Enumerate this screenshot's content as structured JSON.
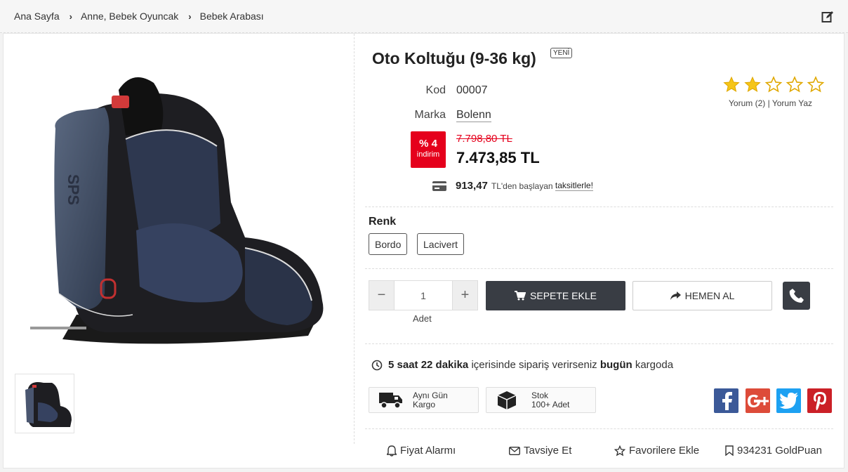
{
  "breadcrumb": {
    "items": [
      "Ana Sayfa",
      "Anne, Bebek Oyuncak",
      "Bebek Arabası"
    ]
  },
  "product": {
    "title": "Oto Koltuğu (9-36 kg)",
    "badge": "YENİ",
    "code_label": "Kod",
    "code_value": "00007",
    "brand_label": "Marka",
    "brand_value": "Bolenn",
    "discount_pct": "% 4",
    "discount_text": "indirim",
    "old_price": "7.798,80 TL",
    "new_price": "7.473,85 TL",
    "installment_amount": "913,47",
    "installment_text": "TL'den başlayan",
    "installment_link": "taksitlerle!"
  },
  "rating": {
    "value": 2,
    "max": 5,
    "reviews_link": "Yorum (2)",
    "separator": "|",
    "write_review_link": "Yorum Yaz"
  },
  "variants": {
    "title": "Renk",
    "options": [
      "Bordo",
      "Lacivert"
    ]
  },
  "quantity": {
    "value": "1",
    "label": "Adet",
    "minus": "−",
    "plus": "+"
  },
  "actions": {
    "add_to_cart": "SEPETE EKLE",
    "buy_now": "HEMEN AL"
  },
  "shipping": {
    "time": "5 saat 22 dakika",
    "middle": "içerisinde sipariş verirseniz",
    "today": "bugün",
    "end": "kargoda"
  },
  "features": {
    "same_day_line1": "Aynı Gün",
    "same_day_line2": "Kargo",
    "stock_line1": "Stok",
    "stock_line2": "100+ Adet"
  },
  "social": {
    "facebook": "#3b5998",
    "google": "#dd4b39",
    "twitter": "#1da1f2",
    "pinterest": "#cb2027"
  },
  "bottom_actions": {
    "price_alarm": "Fiyat Alarmı",
    "recommend": "Tavsiye Et",
    "favorites": "Favorilere Ekle",
    "goldpuan": "934231 GoldPuan"
  },
  "colors": {
    "accent_dark": "#393d44",
    "discount_red": "#e5001c",
    "star_gold": "#f5c518"
  }
}
